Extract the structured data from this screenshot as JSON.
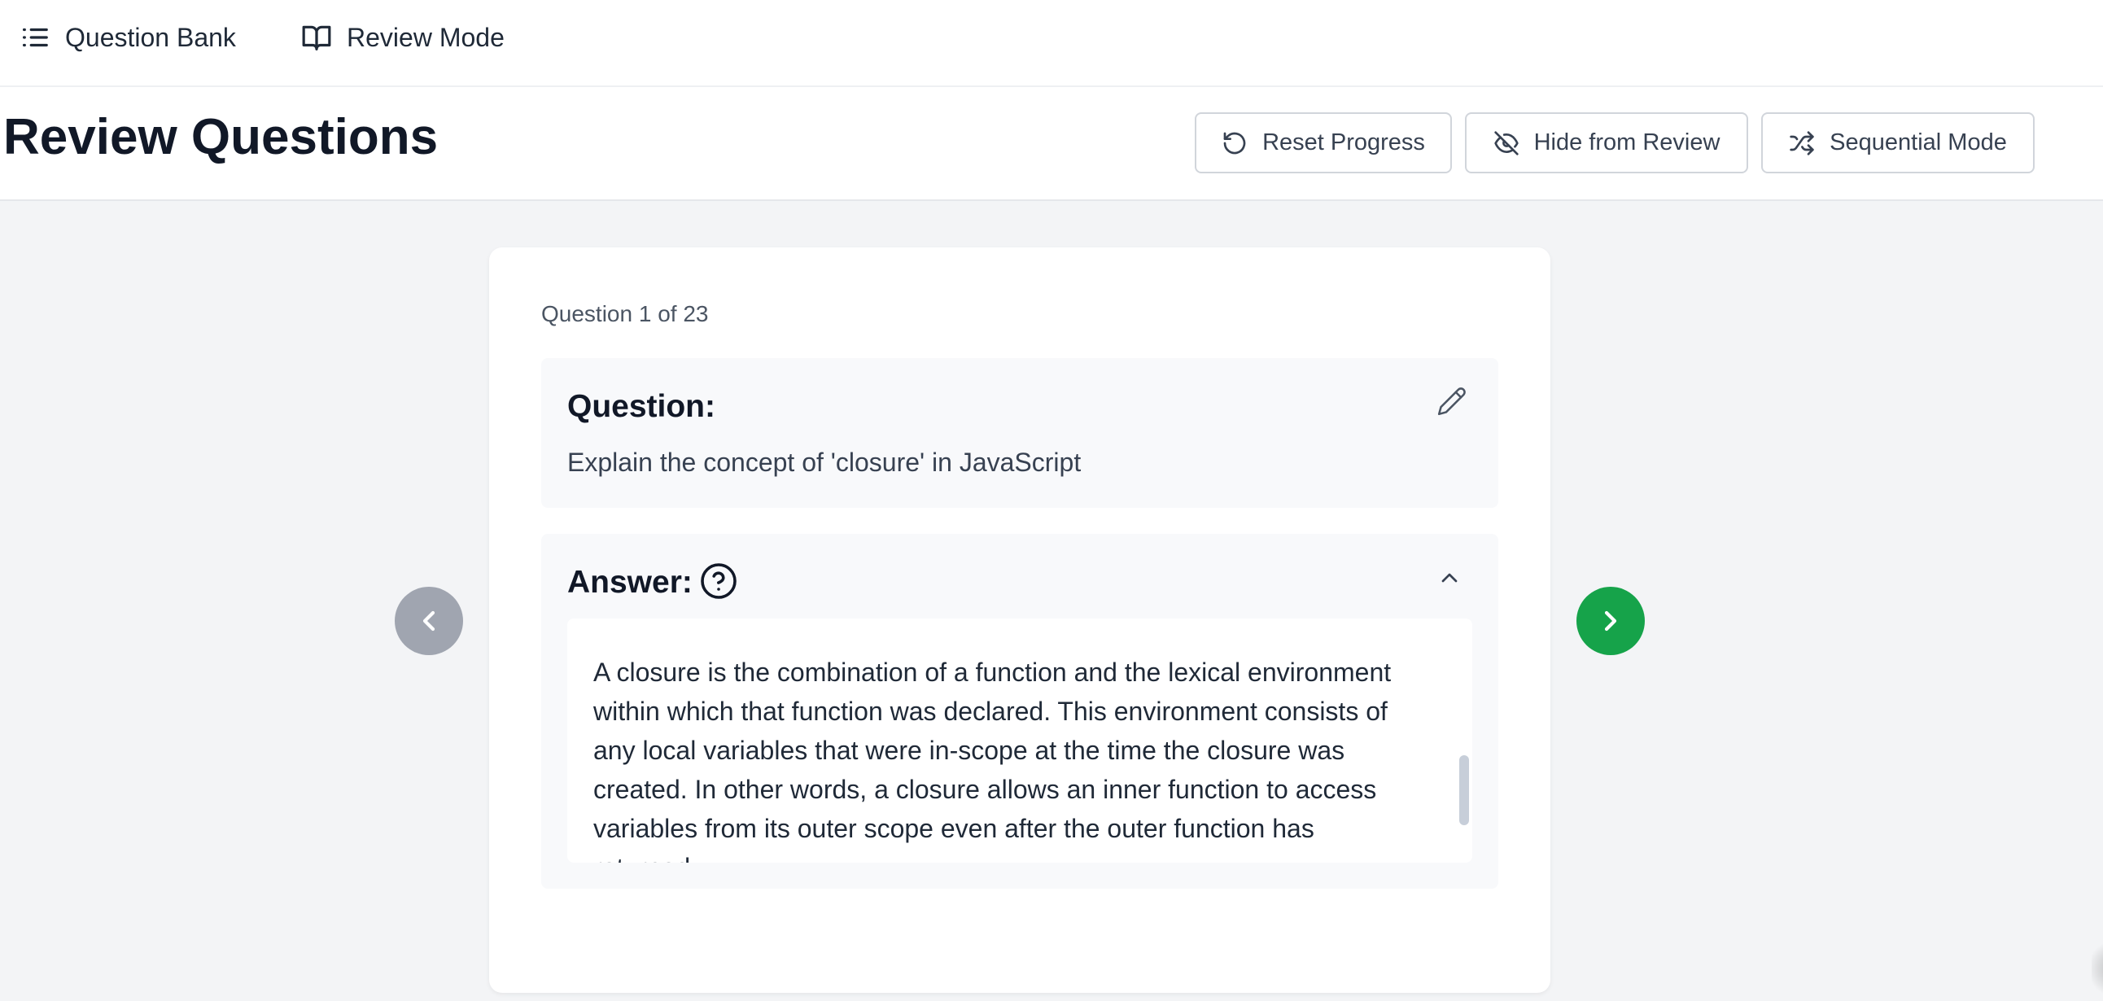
{
  "nav": {
    "items": [
      {
        "label": "Question Bank",
        "icon": "list-icon"
      },
      {
        "label": "Review Mode",
        "icon": "book-open-icon"
      }
    ]
  },
  "header": {
    "title": "Review Questions",
    "buttons": [
      {
        "label": "Reset Progress",
        "icon": "rotate-ccw-icon"
      },
      {
        "label": "Hide from Review",
        "icon": "eye-off-icon"
      },
      {
        "label": "Sequential Mode",
        "icon": "shuffle-icon"
      }
    ]
  },
  "card": {
    "counter": "Question 1 of 23",
    "question": {
      "heading": "Question:",
      "text": "Explain the concept of 'closure' in JavaScript"
    },
    "answer": {
      "heading": "Answer:",
      "text": "A closure is the combination of a function and the lexical environment within which that function was declared. This environment consists of any local variables that were in-scope at the time the closure was created. In other words, a closure allows an inner function to access variables from its outer scope even after the outer function has returned."
    }
  },
  "colors": {
    "next_button": "#16a34a",
    "prev_button": "#a0a5b0",
    "page_background": "#f3f4f6",
    "panel_background": "#f8f9fb"
  }
}
